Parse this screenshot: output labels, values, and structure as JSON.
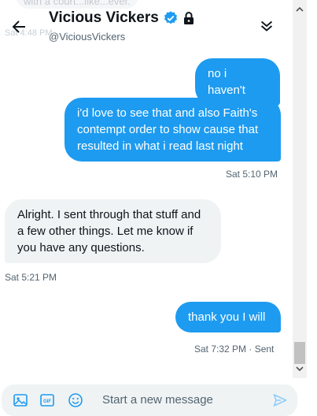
{
  "header": {
    "ghost_message": "with a court...like...ever.",
    "ghost_time": "Sat 4:48 PM",
    "title": "Vicious Vickers",
    "handle": "@ViciousVickers"
  },
  "messages": [
    {
      "direction": "sent",
      "text": "no i haven't"
    },
    {
      "direction": "sent",
      "text": "i'd love to see that and also Faith's contempt order to show cause that resulted in what i read last night",
      "time": "Sat 5:10 PM"
    },
    {
      "direction": "received",
      "text": "Alright. I sent through that stuff and a few other things. Let me know if you have any questions.",
      "time": "Sat 5:21 PM"
    },
    {
      "direction": "sent",
      "text": "thank you I will",
      "time": "Sat 7:32 PM · Sent"
    }
  ],
  "composer": {
    "placeholder": "Start a new message",
    "gif_label": "GIF"
  },
  "colors": {
    "accent": "#1d9bf0",
    "received_bubble": "#eff3f4",
    "secondary_text": "#536471"
  }
}
